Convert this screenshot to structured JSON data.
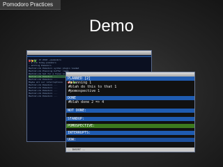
{
  "slide": {
    "header": "Pomodoro Practices",
    "title": "Demo"
  },
  "back_terminal": {
    "lines": [
      "Tue Apr 13 2010 ~/pomodoro",
      "~ $ vim today.pomodoro",
      "~ editing Pomodoro",
      "MacVim:vim Pomodoro syntax plugin loaded",
      "MacVim:vim Planning buffer ready",
      "MacVim:vim  Set for a focus on top of the others",
      "MacVim:vim Pomodoro ...",
      "MacVim:vim  Pomodoro ...",
      "Maybe all our interruptions",
      "MacVim:vim  Pomodoro ...",
      "MacVim:vim  Pomodoro ...",
      "MacVim:vim  Pomodoro ...",
      "MacVim:vim  Pomodoro ...",
      "MacVim:vim  Pomodoro ..."
    ]
  },
  "vim": {
    "sections": {
      "planned": "PLANNED [2]",
      "done": "DONE",
      "not_done": "NOT DONE:",
      "standup": "STANDUP:",
      "pomospective": "POMOSPECTIVE:",
      "interrupts": "INTERRUPTS:",
      "uow": "UOW:"
    },
    "planned_items": [
      "#planning 1",
      "#blah do this to that 1",
      "#pomospective 1"
    ],
    "done_items": [
      "#blah done 2 => 4"
    ],
    "status": "-- INSERT --"
  }
}
